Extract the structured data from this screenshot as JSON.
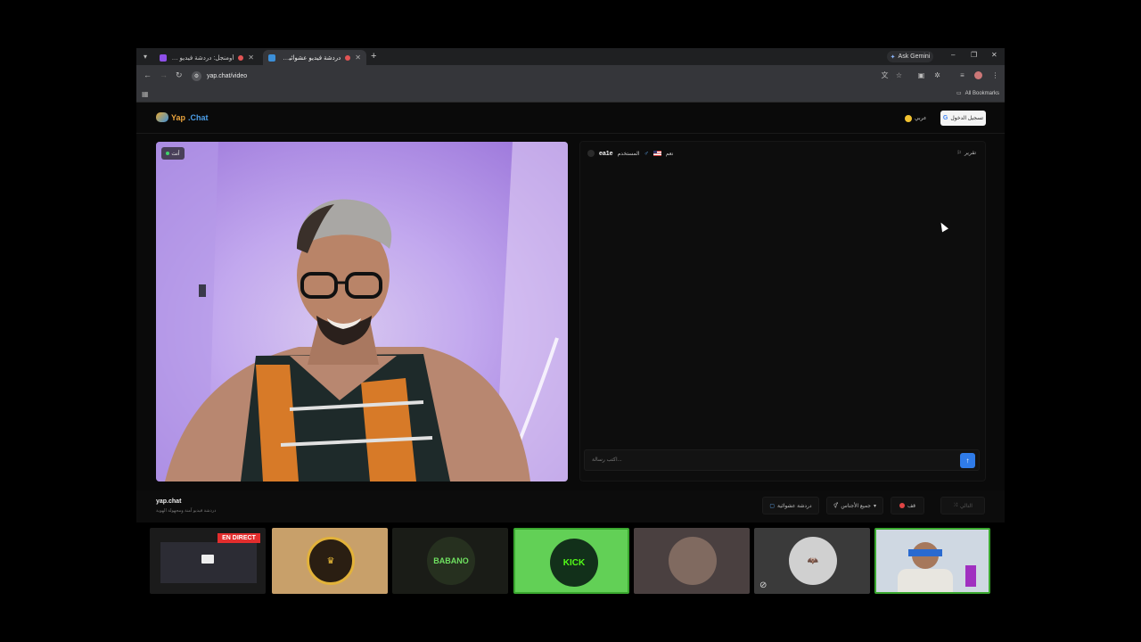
{
  "browser": {
    "tabs": [
      {
        "title": "أومنجل: دردشة فيديو مع الغ",
        "active": false,
        "favicon_color": "#8e4fe8"
      },
      {
        "title": "دردشة فيديو عشوائية: تحدث",
        "active": true,
        "favicon_color": "#3c8fd8"
      }
    ],
    "gemini_label": "Ask Gemini",
    "url": "yap.chat/video",
    "bookmarks_label": "All Bookmarks"
  },
  "site": {
    "logo_yap": "Yap",
    "logo_chat": ".Chat",
    "language_label": "عربي",
    "login_label": "تسجيل الدخول"
  },
  "video": {
    "self_badge": "أنت"
  },
  "chat": {
    "peer_name": "ea1e",
    "peer_role": "المستخدم",
    "peer_country": "نعم",
    "report_label": "تقرير",
    "input_placeholder": "اكتب رسالة...",
    "send_icon": "↑"
  },
  "footer": {
    "brand": "yap.chat",
    "tagline": "دردشة فيديو آمنة ومجهولة الهوية",
    "random_chat_label": "دردشة عشوائية",
    "gender_label": "جميع الأجناس",
    "stop_label": "قف",
    "next_label": "التالي"
  },
  "stream_overlay": {
    "live_label": "EN DIRECT",
    "tile_labels": [
      "KICK",
      "BABANO"
    ]
  }
}
